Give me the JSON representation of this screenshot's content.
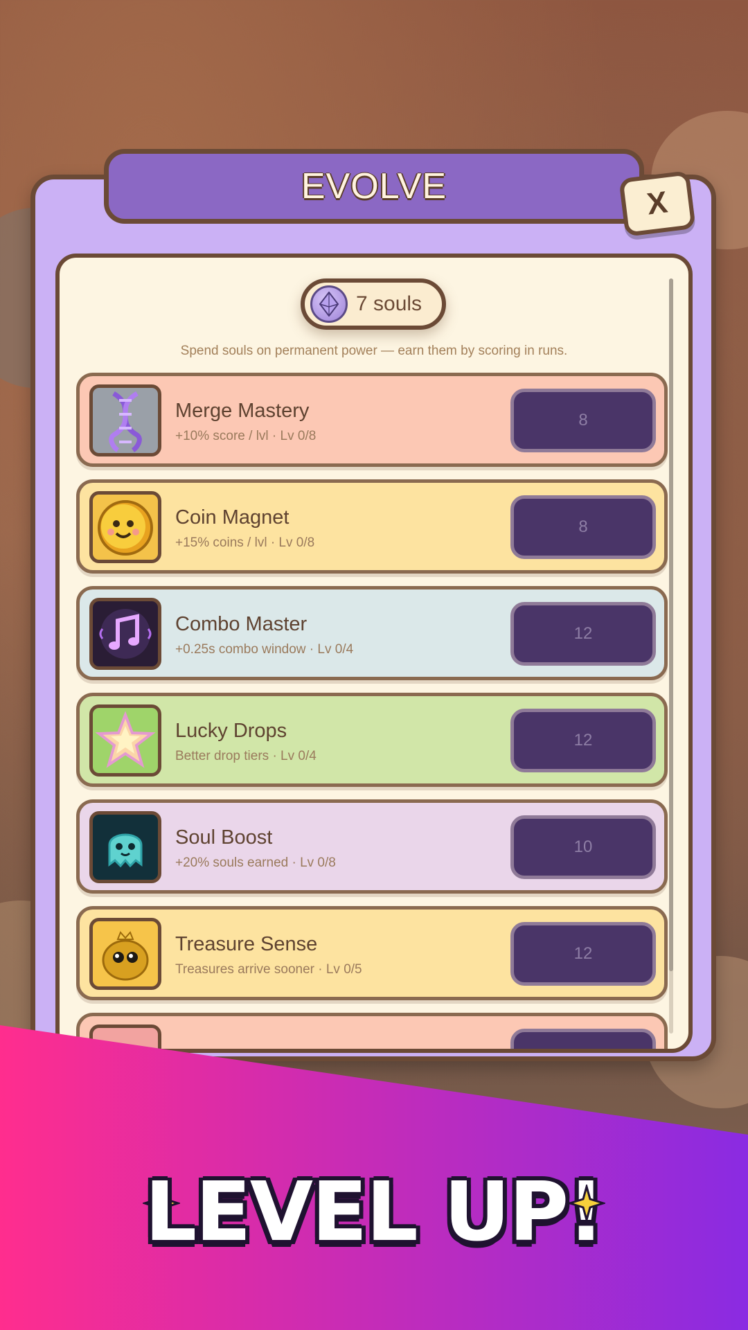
{
  "modal": {
    "title": "EVOLVE",
    "close_label": "X"
  },
  "souls": {
    "balance_label": "7 souls",
    "subtitle": "Spend souls on permanent power — earn them by scoring in runs."
  },
  "upgrades": [
    {
      "name": "Merge Mastery",
      "desc": "+10% score / lvl  ·  Lv 0/8",
      "cost": "8",
      "bg": "#fcc8b4",
      "icon": "dna-icon"
    },
    {
      "name": "Coin Magnet",
      "desc": "+15% coins / lvl  ·  Lv 0/8",
      "cost": "8",
      "bg": "#fde3a0",
      "icon": "coin-icon"
    },
    {
      "name": "Combo Master",
      "desc": "+0.25s combo window  ·  Lv 0/4",
      "cost": "12",
      "bg": "#dbe8e9",
      "icon": "music-note-icon"
    },
    {
      "name": "Lucky Drops",
      "desc": "Better drop tiers  ·  Lv 0/4",
      "cost": "12",
      "bg": "#d1e6a8",
      "icon": "star-icon"
    },
    {
      "name": "Soul Boost",
      "desc": "+20% souls earned  ·  Lv 0/8",
      "cost": "10",
      "bg": "#ead6ea",
      "icon": "ghost-icon"
    },
    {
      "name": "Treasure Sense",
      "desc": "Treasures arrive sooner  ·  Lv 0/5",
      "cost": "12",
      "bg": "#fde3a0",
      "icon": "treasure-blob-icon"
    }
  ],
  "banner": {
    "text": "LEVEL UP!",
    "gradient_start": "#ff2d8e",
    "gradient_end": "#8a2be2"
  }
}
